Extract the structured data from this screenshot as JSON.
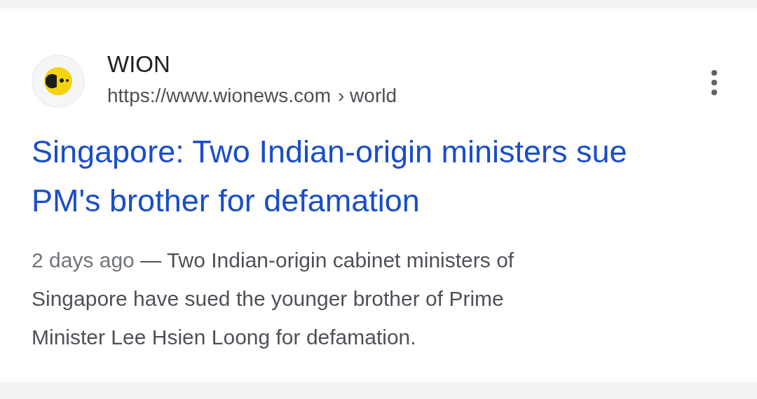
{
  "result": {
    "site_name": "WION",
    "url": "https://www.wionews.com",
    "breadcrumb": "› world",
    "title": "Singapore: Two Indian-origin ministers sue PM's brother for defamation",
    "date": "2 days ago",
    "snippet": "— Two Indian-origin cabinet ministers of Singapore have sued the younger brother of Prime Minister Lee Hsien Loong for defamation."
  }
}
